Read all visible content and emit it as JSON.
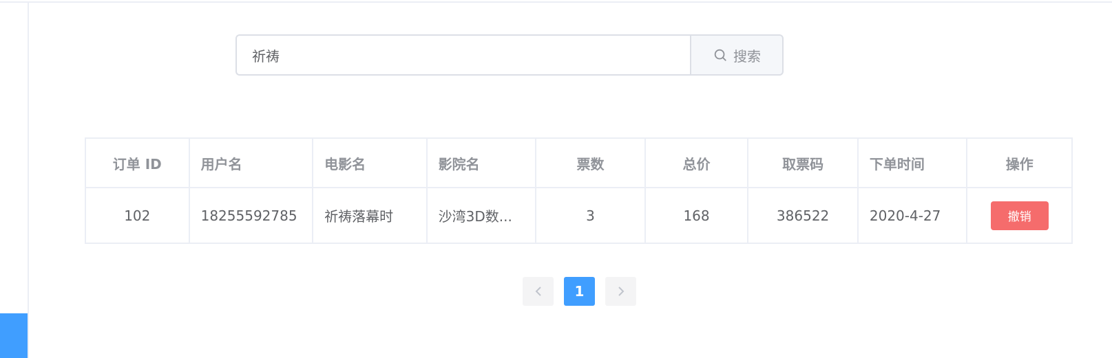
{
  "search": {
    "value": "祈祷",
    "button_label": "搜索"
  },
  "table": {
    "columns": [
      "订单 ID",
      "用户名",
      "电影名",
      "影院名",
      "票数",
      "总价",
      "取票码",
      "下单时间",
      "操作"
    ],
    "rows": [
      {
        "order_id": "102",
        "username": "18255592785",
        "movie": "祈祷落幕时",
        "cinema": "沙湾3D数...",
        "tickets": "3",
        "total": "168",
        "pickup_code": "386522",
        "order_time": "2020-4-27",
        "action_label": "撤销"
      }
    ]
  },
  "pagination": {
    "current_page": "1",
    "prev_icon": "chevron-left-icon",
    "next_icon": "chevron-right-icon"
  },
  "colors": {
    "accent": "#409eff",
    "danger": "#f56c6c"
  }
}
